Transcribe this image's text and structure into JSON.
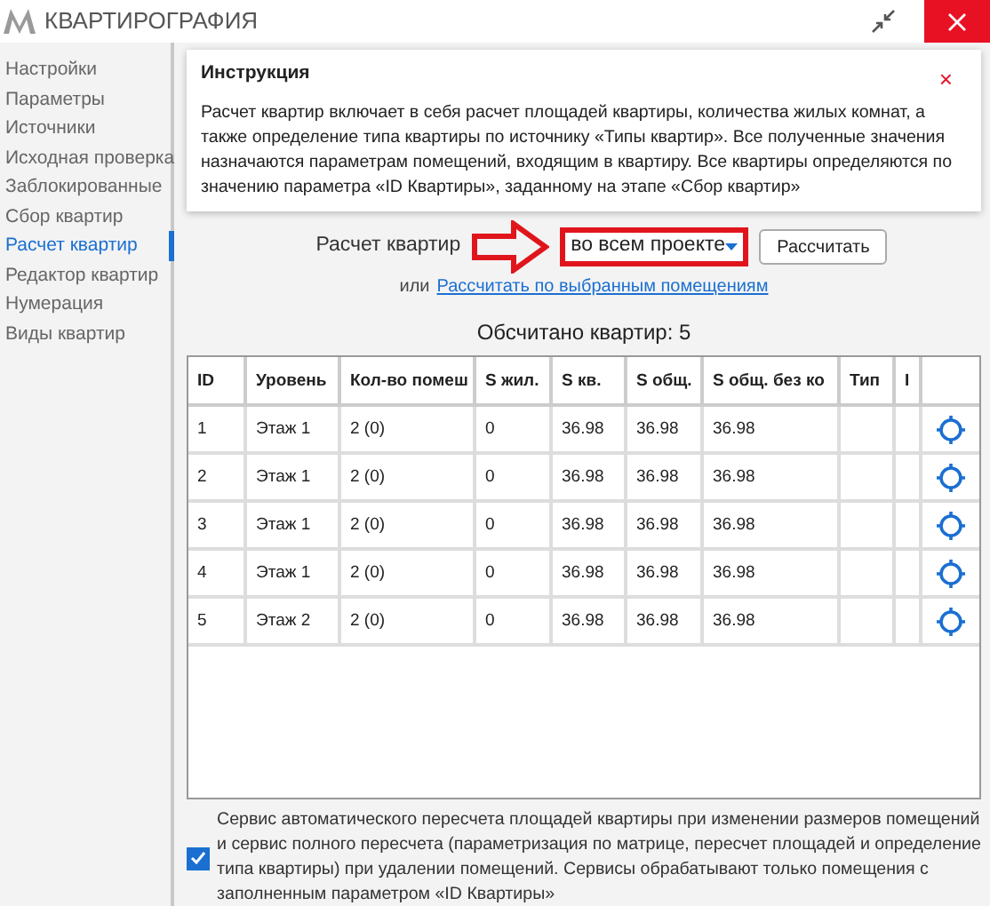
{
  "window": {
    "title": "КВАРТИРОГРАФИЯ"
  },
  "sidebar": {
    "items": [
      {
        "label": "Настройки",
        "selected": false
      },
      {
        "label": "Параметры",
        "selected": false
      },
      {
        "label": "Источники",
        "selected": false
      },
      {
        "label": "Исходная проверка",
        "selected": false
      },
      {
        "label": "Заблокированные",
        "selected": false
      },
      {
        "label": "Сбор квартир",
        "selected": false
      },
      {
        "label": "Расчет квартир",
        "selected": true
      },
      {
        "label": "Редактор квартир",
        "selected": false
      },
      {
        "label": "Нумерация",
        "selected": false
      },
      {
        "label": "Виды квартир",
        "selected": false
      }
    ]
  },
  "instruction": {
    "title": "Инструкция",
    "close": "×",
    "text": "Расчет квартир включает в себя расчет площадей квартиры, количества жилых комнат, а также определение типа квартиры по источнику «Типы квартир». Все полученные значения назначаются параметрам помещений, входящим в квартиру. Все квартиры определяются по значению параметра «ID Квартиры», заданному на этапе «Сбор квартир»"
  },
  "calc": {
    "label": "Расчет квартир",
    "dropdown": "во всем проекте",
    "button": "Рассчитать",
    "or": "или",
    "link": "Рассчитать по выбранным помещениям"
  },
  "summary": "Обсчитано квартир: 5",
  "table": {
    "columns": [
      "ID",
      "Уровень",
      "Кол-во помеш",
      "S жил.",
      "S кв.",
      "S общ.",
      "S общ. без ко",
      "Тип",
      "I"
    ],
    "rows": [
      [
        "1",
        "Этаж 1",
        "2 (0)",
        "0",
        "36.98",
        "36.98",
        "36.98",
        "",
        ""
      ],
      [
        "2",
        "Этаж 1",
        "2 (0)",
        "0",
        "36.98",
        "36.98",
        "36.98",
        "",
        ""
      ],
      [
        "3",
        "Этаж 1",
        "2 (0)",
        "0",
        "36.98",
        "36.98",
        "36.98",
        "",
        ""
      ],
      [
        "4",
        "Этаж 1",
        "2 (0)",
        "0",
        "36.98",
        "36.98",
        "36.98",
        "",
        ""
      ],
      [
        "5",
        "Этаж 2",
        "2 (0)",
        "0",
        "36.98",
        "36.98",
        "36.98",
        "",
        ""
      ]
    ]
  },
  "service": {
    "checked": true,
    "text": "Сервис автоматического пересчета площадей квартиры при изменении размеров помещений и сервис полного пересчета (параметризация по матрице, пересчет площадей и определение типа квартиры) при удалении помещений. Сервисы обрабатывают только помещения с заполненным параметром «ID Квартиры»"
  }
}
